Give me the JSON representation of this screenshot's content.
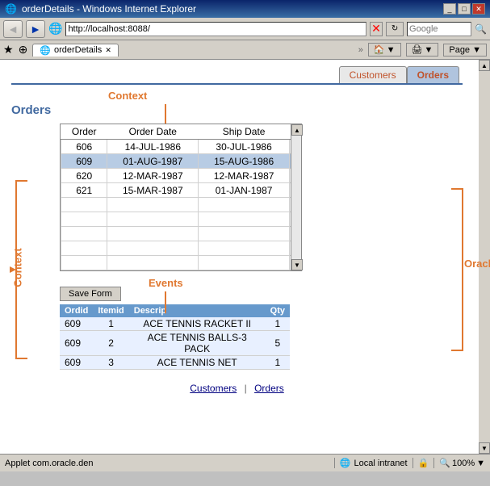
{
  "window": {
    "title": "orderDetails - Windows Internet Explorer",
    "address": "http://localhost:8088/",
    "favicon": "🌐",
    "tab_label": "orderDetails"
  },
  "toolbar": {
    "back_label": "◄",
    "forward_label": "►",
    "refresh_label": "↻",
    "stop_label": "✕",
    "go_label": "⊳",
    "search_placeholder": "Google"
  },
  "favorites_bar": {
    "star_icon": "★",
    "add_fav_icon": "⊕",
    "tab_label": "orderDetails",
    "more_label": "»",
    "page_label": "Page ▼"
  },
  "tabs": [
    {
      "id": "customers",
      "label": "Customers"
    },
    {
      "id": "orders",
      "label": "Orders"
    }
  ],
  "page": {
    "heading": "Orders",
    "annotations": {
      "context_label": "Context",
      "oracle_forms_label": "Oracle Forms",
      "events_label": "Events"
    },
    "orders_table": {
      "headers": [
        "Order",
        "Order Date",
        "Ship Date"
      ],
      "rows": [
        {
          "order": "606",
          "order_date": "14-JUL-1986",
          "ship_date": "30-JUL-1986",
          "selected": false
        },
        {
          "order": "609",
          "order_date": "01-AUG-1987",
          "ship_date": "15-AUG-1986",
          "selected": true
        },
        {
          "order": "620",
          "order_date": "12-MAR-1987",
          "ship_date": "12-MAR-1987",
          "selected": false
        },
        {
          "order": "621",
          "order_date": "15-MAR-1987",
          "ship_date": "01-JAN-1987",
          "selected": false
        },
        {
          "order": "",
          "order_date": "",
          "ship_date": "",
          "selected": false
        },
        {
          "order": "",
          "order_date": "",
          "ship_date": "",
          "selected": false
        },
        {
          "order": "",
          "order_date": "",
          "ship_date": "",
          "selected": false
        },
        {
          "order": "",
          "order_date": "",
          "ship_date": "",
          "selected": false
        },
        {
          "order": "",
          "order_date": "",
          "ship_date": "",
          "selected": false
        }
      ]
    },
    "save_form_btn": "Save Form",
    "detail_table": {
      "headers": [
        "Ordid",
        "Itemid",
        "Descrip",
        "Qty"
      ],
      "rows": [
        {
          "ordid": "609",
          "itemid": "1",
          "descrip": "ACE TENNIS RACKET II",
          "qty": "1"
        },
        {
          "ordid": "609",
          "itemid": "2",
          "descrip": "ACE TENNIS BALLS-3 PACK",
          "qty": "5"
        },
        {
          "ordid": "609",
          "itemid": "3",
          "descrip": "ACE TENNIS NET",
          "qty": "1"
        }
      ]
    },
    "footer_links": [
      {
        "label": "Customers",
        "href": "#customers"
      },
      {
        "label": "Orders",
        "href": "#orders"
      }
    ],
    "footer_separator": "|"
  },
  "status_bar": {
    "applet_text": "Applet com.oracle.den",
    "zone_text": "Local intranet",
    "zoom_text": "100%",
    "zoom_icon": "🔍"
  }
}
